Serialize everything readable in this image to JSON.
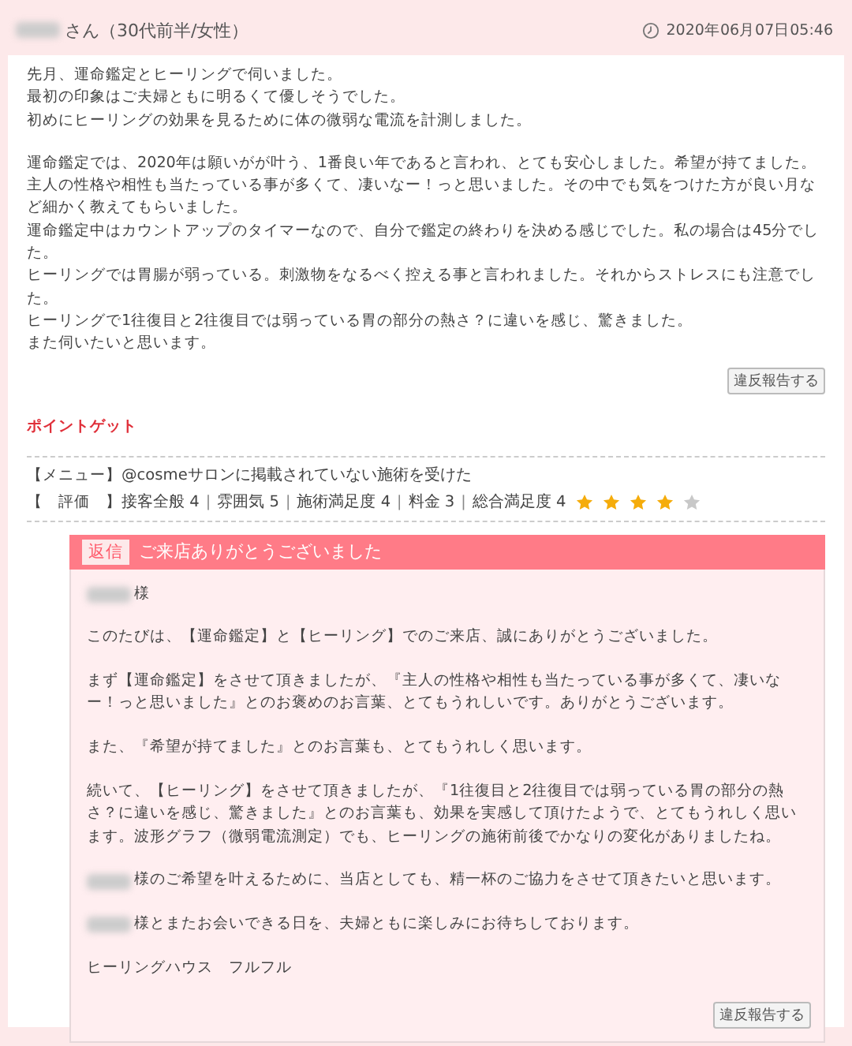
{
  "reviewer": {
    "suffix": "さん（30代前半/女性）",
    "date": "2020年06月07日05:46"
  },
  "review": {
    "paragraphs": [
      [
        "先月、運命鑑定とヒーリングで伺いました。",
        "最初の印象はご夫婦ともに明るくて優しそうでした。",
        "初めにヒーリングの効果を見るために体の微弱な電流を計測しました。"
      ],
      [
        "運命鑑定では、2020年は願いがが叶う、1番良い年であると言われ、とても安心しました。希望が持てました。主人の性格や相性も当たっている事が多くて、凄いなー！っと思いました。その中でも気をつけた方が良い月など細かく教えてもらいました。",
        "運命鑑定中はカウントアップのタイマーなので、自分で鑑定の終わりを決める感じでした。私の場合は45分でした。",
        "ヒーリングでは胃腸が弱っている。刺激物をなるべく控える事と言われました。それからストレスにも注意でした。",
        "ヒーリングで1往復目と2往復目では弱っている胃の部分の熱さ？に違いを感じ、驚きました。",
        "また伺いたいと思います。"
      ]
    ],
    "report_button": "違反報告する"
  },
  "point_label": "ポイントゲット",
  "menu": {
    "label": "【メニュー】",
    "value": "@cosmeサロンに掲載されていない施術を受けた"
  },
  "ratings": {
    "label": "【　評価　】",
    "items": [
      {
        "name": "接客全般",
        "value": "4"
      },
      {
        "name": "雰囲気",
        "value": "5"
      },
      {
        "name": "施術満足度",
        "value": "4"
      },
      {
        "name": "料金",
        "value": "3"
      },
      {
        "name": "総合満足度",
        "value": "4"
      }
    ],
    "separator": "|",
    "stars": 4
  },
  "reply": {
    "badge": "返信",
    "title": "ご来店ありがとうございました",
    "paragraphs": [
      {
        "kind": "redacted",
        "text": "様"
      },
      {
        "kind": "plain",
        "text": "このたびは、【運命鑑定】と【ヒーリング】でのご来店、誠にありがとうございました。"
      },
      {
        "kind": "plain",
        "text": "まず【運命鑑定】をさせて頂きましたが、『主人の性格や相性も当たっている事が多くて、凄いなー！っと思いました』とのお褒めのお言葉、とてもうれしいです。ありがとうございます。"
      },
      {
        "kind": "plain",
        "text": "また、『希望が持てました』とのお言葉も、とてもうれしく思います。"
      },
      {
        "kind": "plain",
        "text": "続いて、【ヒーリング】をさせて頂きましたが、『1往復目と2往復目では弱っている胃の部分の熱さ？に違いを感じ、驚きました』とのお言葉も、効果を実感して頂けたようで、とてもうれしく思います。波形グラフ（微弱電流測定）でも、ヒーリングの施術前後でかなりの変化がありましたね。"
      },
      {
        "kind": "redacted",
        "text": "様のご希望を叶えるために、当店としても、精一杯のご協力をさせて頂きたいと思います。"
      },
      {
        "kind": "redacted",
        "text": "様とまたお会いできる日を、夫婦ともに楽しみにお待ちしております。"
      },
      {
        "kind": "plain",
        "text": "ヒーリングハウス　フルフル"
      }
    ],
    "report_button": "違反報告する"
  }
}
